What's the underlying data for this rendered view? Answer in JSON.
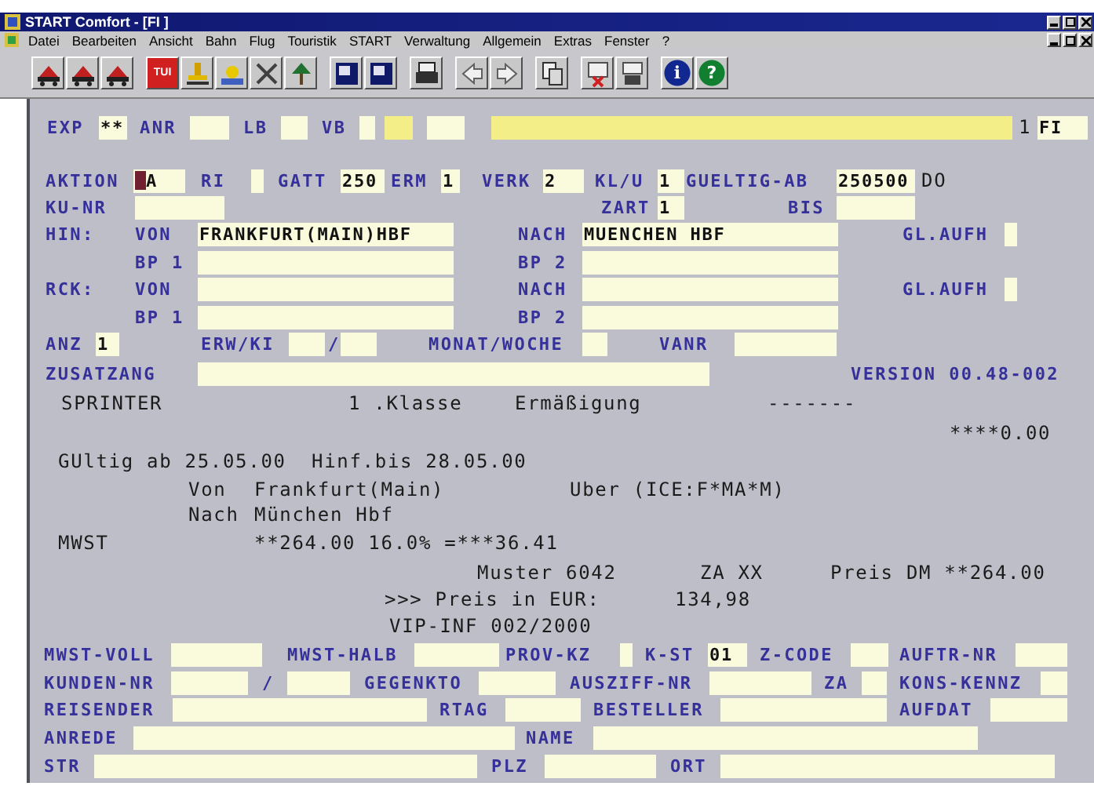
{
  "window": {
    "title": "START Comfort - [FI ]"
  },
  "menu": [
    "Datei",
    "Bearbeiten",
    "Ansicht",
    "Bahn",
    "Flug",
    "Touristik",
    "START",
    "Verwaltung",
    "Allgemein",
    "Extras",
    "Fenster",
    "?"
  ],
  "toolbar": {
    "tui_button": "TUI",
    "info_button": "i",
    "help_button": "?"
  },
  "rows": [
    {
      "items": [
        {
          "kind": "label",
          "text": "EXP"
        },
        {
          "kind": "field",
          "value": "**",
          "highlighted": false
        },
        {
          "kind": "label",
          "text": "ANR"
        },
        {
          "kind": "field",
          "highlighted": false
        },
        {
          "kind": "label",
          "text": "LB"
        },
        {
          "kind": "field",
          "highlighted": false
        },
        {
          "kind": "label",
          "text": "VB"
        },
        {
          "kind": "field",
          "highlighted": false
        },
        {
          "kind": "field",
          "highlighted": true
        },
        {
          "kind": "field",
          "highlighted": false
        },
        {
          "kind": "field",
          "highlighted": true
        },
        {
          "kind": "text",
          "text": "1"
        },
        {
          "kind": "field",
          "value": "FI",
          "highlighted": false
        }
      ]
    },
    {
      "items": [
        {
          "kind": "label",
          "text": "AKTION"
        },
        {
          "kind": "field",
          "value": "A",
          "cursor": true
        },
        {
          "kind": "label",
          "text": "RI"
        },
        {
          "kind": "field"
        },
        {
          "kind": "label",
          "text": "GATT"
        },
        {
          "kind": "field",
          "value": "250"
        },
        {
          "kind": "label",
          "text": "ERM"
        },
        {
          "kind": "field",
          "value": "1"
        },
        {
          "kind": "label",
          "text": "VERK"
        },
        {
          "kind": "field",
          "value": "2"
        },
        {
          "kind": "label",
          "text": "KL/U"
        },
        {
          "kind": "field",
          "value": "1"
        },
        {
          "kind": "label",
          "text": "GUELTIG-AB"
        },
        {
          "kind": "field",
          "value": "250500"
        },
        {
          "kind": "text",
          "text": "DO"
        }
      ]
    },
    {
      "items": [
        {
          "kind": "label",
          "text": "KU-NR"
        },
        {
          "kind": "field"
        },
        {
          "kind": "label",
          "text": "ZART"
        },
        {
          "kind": "field",
          "value": "1"
        },
        {
          "kind": "label",
          "text": "BIS"
        },
        {
          "kind": "field"
        }
      ]
    },
    {
      "items": [
        {
          "kind": "label",
          "text": "HIN:"
        },
        {
          "kind": "label",
          "text": "VON"
        },
        {
          "kind": "field",
          "value": "FRANKFURT(MAIN)HBF"
        },
        {
          "kind": "label",
          "text": "NACH"
        },
        {
          "kind": "field",
          "value": "MUENCHEN HBF"
        },
        {
          "kind": "label",
          "text": "GL.AUFH"
        },
        {
          "kind": "field"
        }
      ]
    },
    {
      "items": [
        {
          "kind": "label",
          "text": "BP 1"
        },
        {
          "kind": "field"
        },
        {
          "kind": "label",
          "text": "BP 2"
        },
        {
          "kind": "field"
        }
      ]
    },
    {
      "items": [
        {
          "kind": "label",
          "text": "RCK:"
        },
        {
          "kind": "label",
          "text": "VON"
        },
        {
          "kind": "field"
        },
        {
          "kind": "label",
          "text": "NACH"
        },
        {
          "kind": "field"
        },
        {
          "kind": "label",
          "text": "GL.AUFH"
        },
        {
          "kind": "field"
        }
      ]
    },
    {
      "items": [
        {
          "kind": "label",
          "text": "BP 1"
        },
        {
          "kind": "field"
        },
        {
          "kind": "label",
          "text": "BP 2"
        },
        {
          "kind": "field"
        }
      ]
    },
    {
      "items": [
        {
          "kind": "label",
          "text": "ANZ"
        },
        {
          "kind": "field",
          "value": "1"
        },
        {
          "kind": "label",
          "text": "ERW/KI"
        },
        {
          "kind": "field"
        },
        {
          "kind": "label",
          "text": "/"
        },
        {
          "kind": "field"
        },
        {
          "kind": "label",
          "text": "MONAT/WOCHE"
        },
        {
          "kind": "field"
        },
        {
          "kind": "label",
          "text": "VANR"
        },
        {
          "kind": "field"
        }
      ]
    },
    {
      "items": [
        {
          "kind": "label",
          "text": "ZUSATZANG"
        },
        {
          "kind": "field"
        },
        {
          "kind": "label",
          "text": "VERSION 00.48-002"
        }
      ]
    },
    {
      "items": [
        {
          "kind": "text",
          "text": "SPRINTER"
        },
        {
          "kind": "text",
          "text": "1 .Klasse"
        },
        {
          "kind": "text",
          "text": "Ermäßigung"
        },
        {
          "kind": "text",
          "text": "-------"
        }
      ]
    },
    {
      "items": [
        {
          "kind": "text",
          "text": "****0.00"
        }
      ]
    },
    {
      "items": [
        {
          "kind": "text",
          "text": "GUltig ab 25.05.00  Hinf.bis 28.05.00"
        }
      ]
    },
    {
      "items": [
        {
          "kind": "text",
          "text": "Von"
        },
        {
          "kind": "text",
          "text": "Frankfurt(Main)"
        },
        {
          "kind": "text",
          "text": "Uber (ICE:F*MA*M)"
        }
      ]
    },
    {
      "items": [
        {
          "kind": "text",
          "text": "Nach"
        },
        {
          "kind": "text",
          "text": "München Hbf"
        }
      ]
    },
    {
      "items": [
        {
          "kind": "text",
          "text": "MWST"
        },
        {
          "kind": "text",
          "text": "**264.00 16.0% =***36.41"
        }
      ]
    },
    {
      "items": [
        {
          "kind": "text",
          "text": "Muster 6042"
        },
        {
          "kind": "text",
          "text": "ZA XX"
        },
        {
          "kind": "text",
          "text": "Preis DM **264.00"
        }
      ]
    },
    {
      "items": [
        {
          "kind": "text",
          "text": ">>> Preis in EUR:"
        },
        {
          "kind": "text",
          "text": "134,98"
        }
      ]
    },
    {
      "items": [
        {
          "kind": "text",
          "text": "VIP-INF 002/2000"
        }
      ]
    },
    {
      "items": [
        {
          "kind": "label",
          "text": "MWST-VOLL"
        },
        {
          "kind": "field"
        },
        {
          "kind": "label",
          "text": "MWST-HALB"
        },
        {
          "kind": "field"
        },
        {
          "kind": "label",
          "text": "PROV-KZ"
        },
        {
          "kind": "field"
        },
        {
          "kind": "label",
          "text": "K-ST"
        },
        {
          "kind": "field",
          "value": "01"
        },
        {
          "kind": "label",
          "text": "Z-CODE"
        },
        {
          "kind": "field"
        },
        {
          "kind": "label",
          "text": "AUFTR-NR"
        },
        {
          "kind": "field"
        }
      ]
    },
    {
      "items": [
        {
          "kind": "label",
          "text": "KUNDEN-NR"
        },
        {
          "kind": "field"
        },
        {
          "kind": "label",
          "text": "/"
        },
        {
          "kind": "field"
        },
        {
          "kind": "label",
          "text": "GEGENKTO"
        },
        {
          "kind": "field"
        },
        {
          "kind": "label",
          "text": "AUSZIFF-NR"
        },
        {
          "kind": "field"
        },
        {
          "kind": "label",
          "text": "ZA"
        },
        {
          "kind": "field"
        },
        {
          "kind": "label",
          "text": "KONS-KENNZ"
        },
        {
          "kind": "field"
        }
      ]
    },
    {
      "items": [
        {
          "kind": "label",
          "text": "REISENDER"
        },
        {
          "kind": "field"
        },
        {
          "kind": "label",
          "text": "RTAG"
        },
        {
          "kind": "field"
        },
        {
          "kind": "label",
          "text": "BESTELLER"
        },
        {
          "kind": "field"
        },
        {
          "kind": "label",
          "text": "AUFDAT"
        },
        {
          "kind": "field"
        }
      ]
    },
    {
      "items": [
        {
          "kind": "label",
          "text": "ANREDE"
        },
        {
          "kind": "field"
        },
        {
          "kind": "label",
          "text": "NAME"
        },
        {
          "kind": "field"
        }
      ]
    },
    {
      "items": [
        {
          "kind": "label",
          "text": "STR"
        },
        {
          "kind": "field"
        },
        {
          "kind": "label",
          "text": "PLZ"
        },
        {
          "kind": "field"
        },
        {
          "kind": "label",
          "text": "ORT"
        },
        {
          "kind": "field"
        }
      ]
    }
  ]
}
